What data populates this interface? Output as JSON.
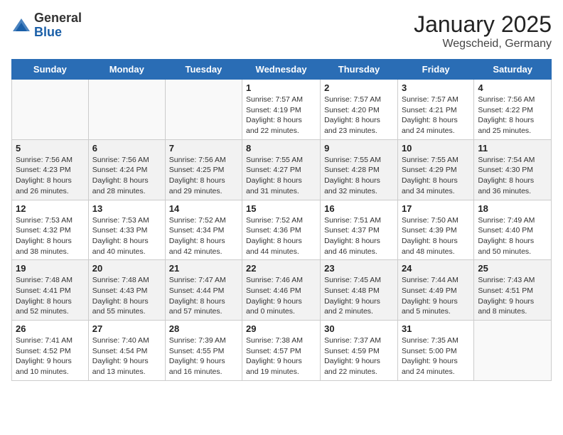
{
  "header": {
    "logo_general": "General",
    "logo_blue": "Blue",
    "title": "January 2025",
    "subtitle": "Wegscheid, Germany"
  },
  "days_of_week": [
    "Sunday",
    "Monday",
    "Tuesday",
    "Wednesday",
    "Thursday",
    "Friday",
    "Saturday"
  ],
  "weeks": [
    [
      {
        "day": "",
        "info": ""
      },
      {
        "day": "",
        "info": ""
      },
      {
        "day": "",
        "info": ""
      },
      {
        "day": "1",
        "info": "Sunrise: 7:57 AM\nSunset: 4:19 PM\nDaylight: 8 hours\nand 22 minutes."
      },
      {
        "day": "2",
        "info": "Sunrise: 7:57 AM\nSunset: 4:20 PM\nDaylight: 8 hours\nand 23 minutes."
      },
      {
        "day": "3",
        "info": "Sunrise: 7:57 AM\nSunset: 4:21 PM\nDaylight: 8 hours\nand 24 minutes."
      },
      {
        "day": "4",
        "info": "Sunrise: 7:56 AM\nSunset: 4:22 PM\nDaylight: 8 hours\nand 25 minutes."
      }
    ],
    [
      {
        "day": "5",
        "info": "Sunrise: 7:56 AM\nSunset: 4:23 PM\nDaylight: 8 hours\nand 26 minutes."
      },
      {
        "day": "6",
        "info": "Sunrise: 7:56 AM\nSunset: 4:24 PM\nDaylight: 8 hours\nand 28 minutes."
      },
      {
        "day": "7",
        "info": "Sunrise: 7:56 AM\nSunset: 4:25 PM\nDaylight: 8 hours\nand 29 minutes."
      },
      {
        "day": "8",
        "info": "Sunrise: 7:55 AM\nSunset: 4:27 PM\nDaylight: 8 hours\nand 31 minutes."
      },
      {
        "day": "9",
        "info": "Sunrise: 7:55 AM\nSunset: 4:28 PM\nDaylight: 8 hours\nand 32 minutes."
      },
      {
        "day": "10",
        "info": "Sunrise: 7:55 AM\nSunset: 4:29 PM\nDaylight: 8 hours\nand 34 minutes."
      },
      {
        "day": "11",
        "info": "Sunrise: 7:54 AM\nSunset: 4:30 PM\nDaylight: 8 hours\nand 36 minutes."
      }
    ],
    [
      {
        "day": "12",
        "info": "Sunrise: 7:53 AM\nSunset: 4:32 PM\nDaylight: 8 hours\nand 38 minutes."
      },
      {
        "day": "13",
        "info": "Sunrise: 7:53 AM\nSunset: 4:33 PM\nDaylight: 8 hours\nand 40 minutes."
      },
      {
        "day": "14",
        "info": "Sunrise: 7:52 AM\nSunset: 4:34 PM\nDaylight: 8 hours\nand 42 minutes."
      },
      {
        "day": "15",
        "info": "Sunrise: 7:52 AM\nSunset: 4:36 PM\nDaylight: 8 hours\nand 44 minutes."
      },
      {
        "day": "16",
        "info": "Sunrise: 7:51 AM\nSunset: 4:37 PM\nDaylight: 8 hours\nand 46 minutes."
      },
      {
        "day": "17",
        "info": "Sunrise: 7:50 AM\nSunset: 4:39 PM\nDaylight: 8 hours\nand 48 minutes."
      },
      {
        "day": "18",
        "info": "Sunrise: 7:49 AM\nSunset: 4:40 PM\nDaylight: 8 hours\nand 50 minutes."
      }
    ],
    [
      {
        "day": "19",
        "info": "Sunrise: 7:48 AM\nSunset: 4:41 PM\nDaylight: 8 hours\nand 52 minutes."
      },
      {
        "day": "20",
        "info": "Sunrise: 7:48 AM\nSunset: 4:43 PM\nDaylight: 8 hours\nand 55 minutes."
      },
      {
        "day": "21",
        "info": "Sunrise: 7:47 AM\nSunset: 4:44 PM\nDaylight: 8 hours\nand 57 minutes."
      },
      {
        "day": "22",
        "info": "Sunrise: 7:46 AM\nSunset: 4:46 PM\nDaylight: 9 hours\nand 0 minutes."
      },
      {
        "day": "23",
        "info": "Sunrise: 7:45 AM\nSunset: 4:48 PM\nDaylight: 9 hours\nand 2 minutes."
      },
      {
        "day": "24",
        "info": "Sunrise: 7:44 AM\nSunset: 4:49 PM\nDaylight: 9 hours\nand 5 minutes."
      },
      {
        "day": "25",
        "info": "Sunrise: 7:43 AM\nSunset: 4:51 PM\nDaylight: 9 hours\nand 8 minutes."
      }
    ],
    [
      {
        "day": "26",
        "info": "Sunrise: 7:41 AM\nSunset: 4:52 PM\nDaylight: 9 hours\nand 10 minutes."
      },
      {
        "day": "27",
        "info": "Sunrise: 7:40 AM\nSunset: 4:54 PM\nDaylight: 9 hours\nand 13 minutes."
      },
      {
        "day": "28",
        "info": "Sunrise: 7:39 AM\nSunset: 4:55 PM\nDaylight: 9 hours\nand 16 minutes."
      },
      {
        "day": "29",
        "info": "Sunrise: 7:38 AM\nSunset: 4:57 PM\nDaylight: 9 hours\nand 19 minutes."
      },
      {
        "day": "30",
        "info": "Sunrise: 7:37 AM\nSunset: 4:59 PM\nDaylight: 9 hours\nand 22 minutes."
      },
      {
        "day": "31",
        "info": "Sunrise: 7:35 AM\nSunset: 5:00 PM\nDaylight: 9 hours\nand 24 minutes."
      },
      {
        "day": "",
        "info": ""
      }
    ]
  ]
}
